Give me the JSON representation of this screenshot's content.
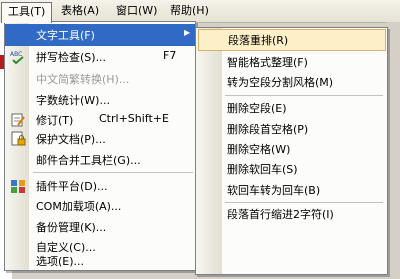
{
  "menubar": {
    "items": [
      "工具(T)",
      "表格(A)",
      "窗口(W)",
      "帮助(H)"
    ]
  },
  "tools_menu": {
    "items": [
      {
        "label": "文字工具(F)",
        "shortcut": "",
        "submenu": true,
        "icon": "none"
      },
      {
        "label": "拼写检查(S)...",
        "shortcut": "F7",
        "icon": "spellcheck-icon"
      },
      {
        "label": "中文简繁转换(H)...",
        "shortcut": "",
        "disabled": true,
        "icon": "none"
      },
      {
        "label": "字数统计(W)...",
        "shortcut": "",
        "icon": "none"
      },
      {
        "label": "修订(T)",
        "shortcut": "Ctrl+Shift+E",
        "icon": "track-changes-icon"
      },
      {
        "label": "保护文档(P)...",
        "shortcut": "",
        "icon": "protect-document-icon"
      },
      {
        "label": "邮件合并工具栏(G)...",
        "shortcut": "",
        "icon": "none"
      },
      {
        "label": "插件平台(D)...",
        "shortcut": "",
        "icon": "plugin-platform-icon"
      },
      {
        "label": "COM加载项(A)...",
        "shortcut": "",
        "icon": "none"
      },
      {
        "label": "备份管理(K)...",
        "shortcut": "",
        "icon": "none"
      },
      {
        "label": "自定义(C)...",
        "shortcut": "",
        "icon": "none"
      },
      {
        "label": "选项(E)...",
        "shortcut": "",
        "icon": "none"
      }
    ],
    "submenu_arrow": "▶"
  },
  "text_tools_submenu": {
    "items": [
      "段落重排(R)",
      "智能格式整理(F)",
      "转为空段分割风格(M)",
      "删除空段(E)",
      "删除段首空格(P)",
      "删除空格(W)",
      "删除软回车(S)",
      "软回车转为回车(B)",
      "段落首行缩进2字符(I)"
    ]
  },
  "colors": {
    "highlight": "#316ac5",
    "submenu_hover": "#fdf0c8",
    "menu_bg": "#fcfcfa"
  }
}
